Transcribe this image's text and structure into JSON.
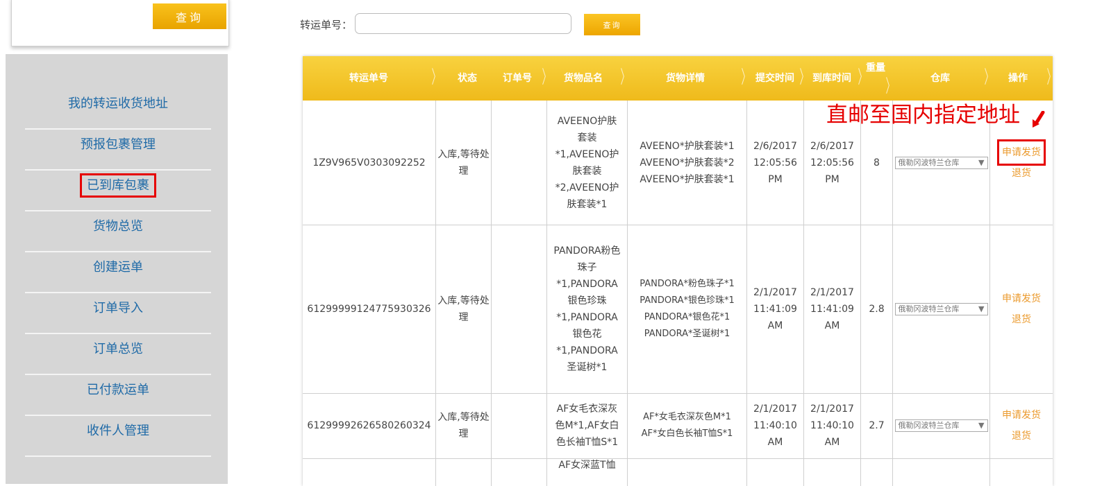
{
  "sidebar": {
    "query_button": "查询",
    "items": [
      {
        "label": "我的转运收货地址"
      },
      {
        "label": "预报包裹管理"
      },
      {
        "label": "已到库包裹"
      },
      {
        "label": "货物总览"
      },
      {
        "label": "创建运单"
      },
      {
        "label": "订单导入"
      },
      {
        "label": "订单总览"
      },
      {
        "label": "已付款运单"
      },
      {
        "label": "收件人管理"
      }
    ],
    "active_item": "已到库包裹"
  },
  "search": {
    "label": "转运单号：",
    "value": "",
    "placeholder": "",
    "button": "查询"
  },
  "table": {
    "columns": [
      "转运单号",
      "状态",
      "订单号",
      "货物品名",
      "货物详情",
      "提交时间",
      "到库时间",
      "重量",
      "仓库",
      "操作"
    ],
    "rows": [
      {
        "tracking": "1Z9V965V0303092252",
        "status": "入库,等待处理",
        "order_no": "",
        "goods_name": "AVEENO护肤套装*1,AVEENO护肤套装*2,AVEENO护肤套装*1",
        "goods_detail": "AVEENO*护肤套装*1\nAVEENO*护肤套装*2\nAVEENO*护肤套装*1",
        "submit_time": "2/6/2017\n12:05:56\nPM",
        "arrive_time": "2/6/2017\n12:05:56\nPM",
        "weight": "8",
        "warehouse": "俄勒冈波特兰仓库",
        "op_apply": "申请发货",
        "op_return": "退货"
      },
      {
        "tracking": "61299999124775930326",
        "status": "入库,等待处理",
        "order_no": "",
        "goods_name": "PANDORA粉色珠子*1,PANDORA银色珍珠*1,PANDORA银色花*1,PANDORA圣诞树*1",
        "goods_detail": "PANDORA*粉色珠子*1\nPANDORA*银色珍珠*1\nPANDORA*银色花*1\nPANDORA*圣诞树*1",
        "submit_time": "2/1/2017\n11:41:09\nAM",
        "arrive_time": "2/1/2017\n11:41:09\nAM",
        "weight": "2.8",
        "warehouse": "俄勒冈波特兰仓库",
        "op_apply": "申请发货",
        "op_return": "退货"
      },
      {
        "tracking": "61299992626580260324",
        "status": "入库,等待处理",
        "order_no": "",
        "goods_name": "AF女毛衣深灰色M*1,AF女白色长袖T恤S*1",
        "goods_detail": "AF*女毛衣深灰色M*1\nAF*女白色长袖T恤S*1",
        "submit_time": "2/1/2017\n11:40:10\nAM",
        "arrive_time": "2/1/2017\n11:40:10\nAM",
        "weight": "2.7",
        "warehouse": "俄勒冈波特兰仓库",
        "op_apply": "申请发货",
        "op_return": "退货"
      },
      {
        "goods_name_partial": "AF女深蓝T恤"
      }
    ]
  },
  "annotation": {
    "text": "直邮至国内指定地址",
    "color": "#e60000"
  },
  "colors": {
    "accent": "#f0b41f",
    "link": "#1f6aa7",
    "op_link": "#eb9a2d",
    "highlight": "#e60000"
  }
}
